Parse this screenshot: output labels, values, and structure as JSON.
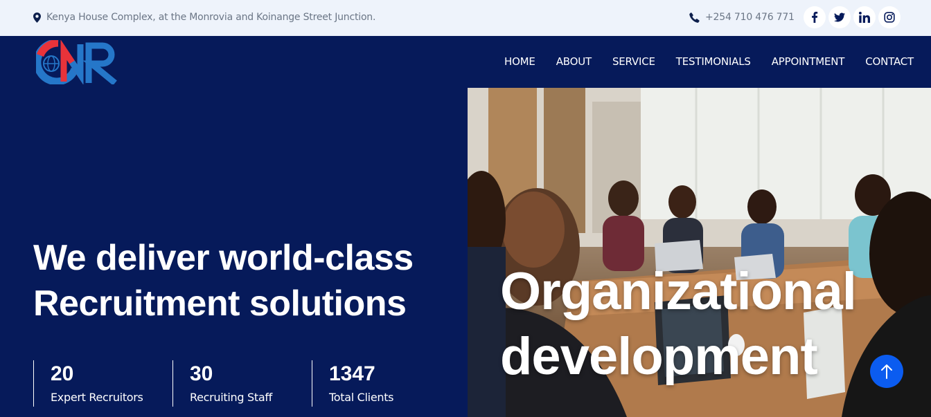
{
  "topbar": {
    "address": "Kenya House Complex, at the Monrovia and Koinange Street Junction.",
    "phone": "+254 710 476 771",
    "socials": [
      {
        "icon": "facebook-icon"
      },
      {
        "icon": "twitter-icon"
      },
      {
        "icon": "linkedin-icon"
      },
      {
        "icon": "instagram-icon"
      }
    ]
  },
  "brand": {
    "logo_text": "ONR",
    "colors": {
      "navy": "#061a5a",
      "red": "#e8333a",
      "blue": "#2577c9"
    }
  },
  "nav": {
    "items": [
      "HOME",
      "ABOUT",
      "SERVICE",
      "TESTIMONIALS",
      "APPOINTMENT",
      "CONTACT"
    ]
  },
  "hero": {
    "title_line1": "We deliver world-class",
    "title_line2": "Recruitment solutions",
    "stats": [
      {
        "value": "20",
        "label": "Expert Recruitors"
      },
      {
        "value": "30",
        "label": "Recruiting Staff"
      },
      {
        "value": "1347",
        "label": "Total Clients"
      }
    ]
  },
  "slide": {
    "caption_line1": "Organizational",
    "caption_line2": "development"
  },
  "colors": {
    "accent": "#0b5cf0",
    "topbar_bg": "#eef3fb",
    "hero_bg": "#061a5a"
  }
}
